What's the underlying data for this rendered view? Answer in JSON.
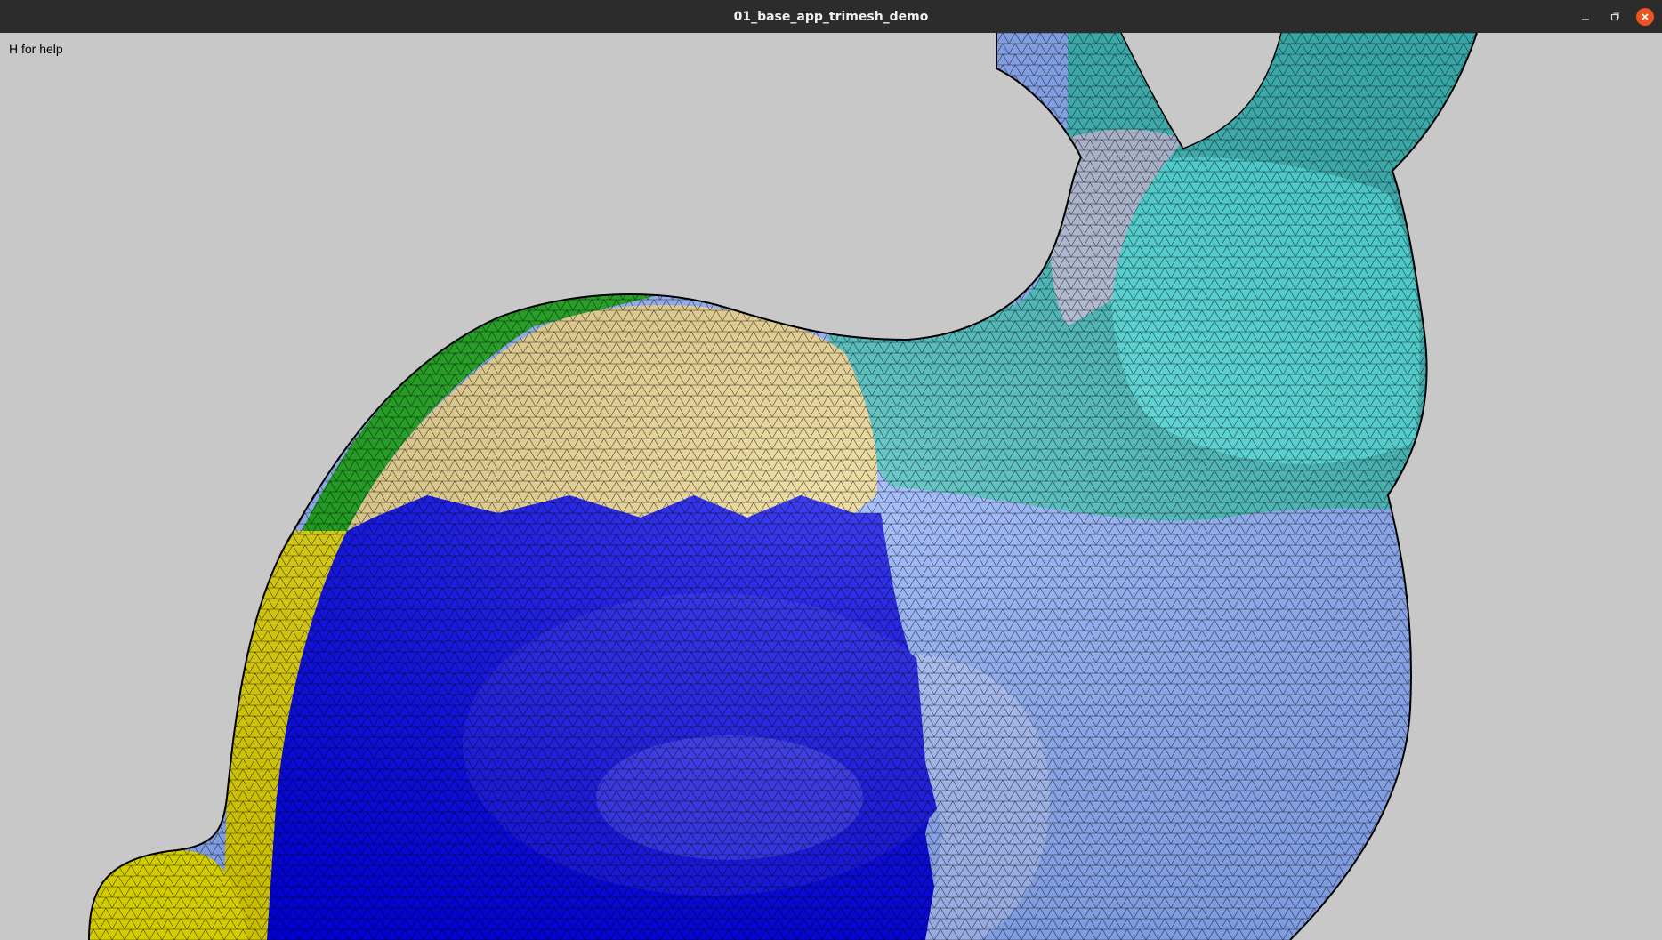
{
  "window": {
    "title": "01_base_app_trimesh_demo",
    "controls": {
      "minimize": "minimize-icon",
      "maximize": "restore-icon",
      "close": "close-icon"
    }
  },
  "viewport": {
    "help_text": "H for help",
    "background": "#c8c8c8",
    "model": "bunny mesh",
    "regions": [
      {
        "name": "ears",
        "color": "#3fbcbc"
      },
      {
        "name": "head",
        "color": "#45d6d6"
      },
      {
        "name": "neck",
        "color": "#b6c2dd"
      },
      {
        "name": "back-green",
        "color": "#0fa00f"
      },
      {
        "name": "back-tan",
        "color": "#ead38a"
      },
      {
        "name": "side-yellow",
        "color": "#e6d800"
      },
      {
        "name": "flank-blue",
        "color": "#0000ee"
      },
      {
        "name": "chest-lightblue",
        "color": "#8fb0ff"
      },
      {
        "name": "tail-yellow",
        "color": "#f0e800"
      }
    ],
    "wireframe": true
  }
}
